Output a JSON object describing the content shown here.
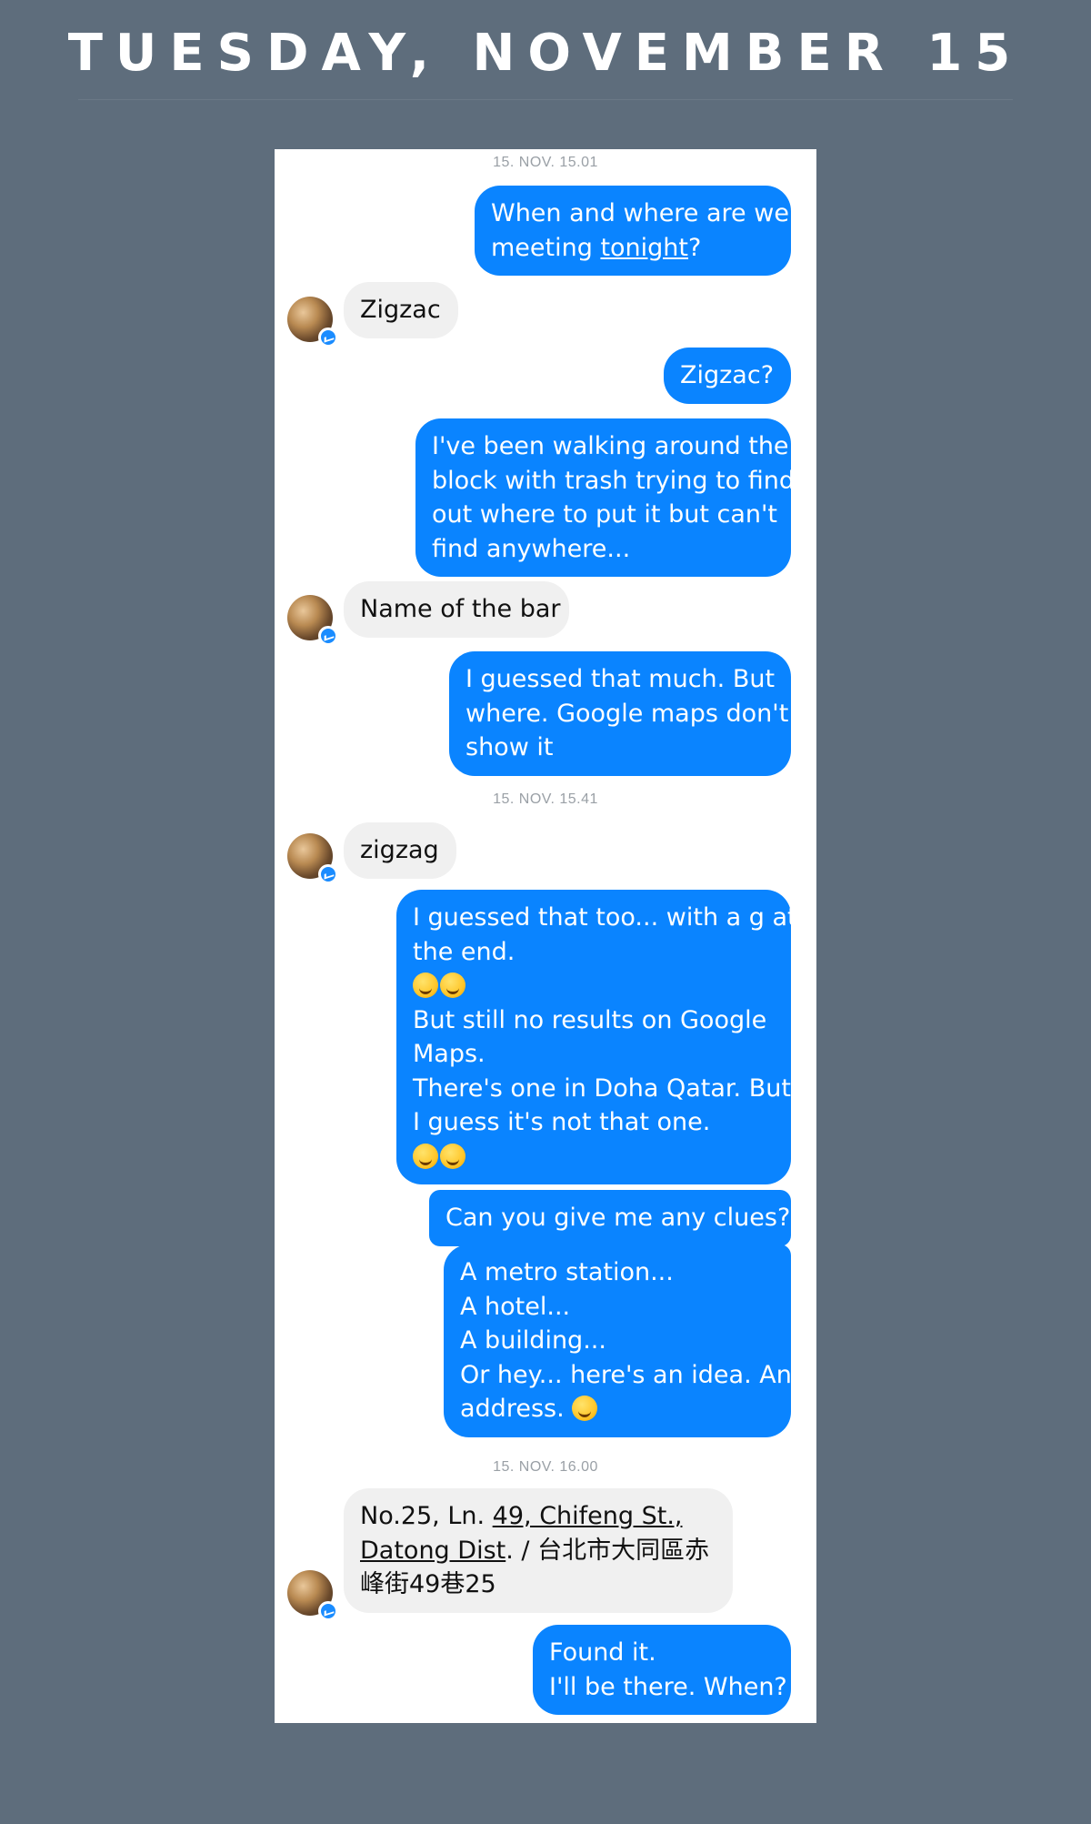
{
  "header": {
    "title": "TUESDAY, NOVEMBER 15"
  },
  "chat": {
    "timestamps": [
      "15. NOV. 15.01",
      "15. NOV. 15.41",
      "15. NOV. 16.00"
    ],
    "messages": [
      {
        "dir": "out",
        "lines": [
          "When and where are we",
          "meeting ",
          "tonight",
          "?"
        ]
      },
      {
        "dir": "in",
        "lines": [
          "Zigzac"
        ]
      },
      {
        "dir": "out",
        "lines": [
          "Zigzac?"
        ]
      },
      {
        "dir": "out",
        "lines": [
          "I've been walking around the",
          "block with trash trying to find",
          "out where to put it but can't",
          "find anywhere..."
        ]
      },
      {
        "dir": "in",
        "lines": [
          "Name of the bar"
        ]
      },
      {
        "dir": "out",
        "lines": [
          "I guessed that much. But",
          "where. Google maps don't",
          "show it"
        ]
      },
      {
        "dir": "in",
        "lines": [
          "zigzag"
        ]
      },
      {
        "dir": "out",
        "lines": [
          "I guessed that too... with a g at",
          "the end.",
          "But still no results on Google",
          "Maps.",
          "There's one in Doha Qatar. But",
          "I guess it's not that one."
        ]
      },
      {
        "dir": "out",
        "lines": [
          "Can you give me any clues?"
        ]
      },
      {
        "dir": "out",
        "lines": [
          "A metro station...",
          "A hotel...",
          "A building...",
          "Or hey... here's an idea. An",
          "address. "
        ]
      },
      {
        "dir": "in",
        "lines": [
          "No.25, Ln. ",
          "49, Chifeng St.,",
          "Datong Dist",
          ". / 台北市大同區赤",
          "峰街49巷25"
        ]
      },
      {
        "dir": "out",
        "lines": [
          "Found it.",
          "I'll be there. When?"
        ]
      }
    ]
  },
  "icons": {
    "avatar": "contact-avatar",
    "badge": "messenger-badge-icon",
    "emoji_laugh": "tears-of-joy-emoji-icon",
    "emoji_wink": "winking-tongue-emoji-icon",
    "emoji_smile": "smiling-face-emoji-icon"
  },
  "colors": {
    "background": "#5e6d7c",
    "outgoing_bubble": "#0a84ff",
    "incoming_bubble": "#f0f0f0",
    "timestamp": "#9aa0a6"
  }
}
